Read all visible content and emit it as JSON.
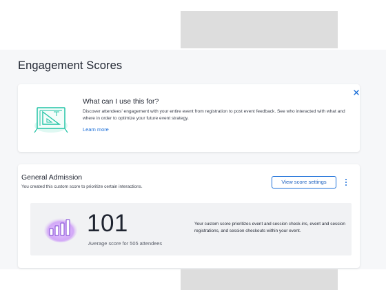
{
  "page": {
    "title": "Engagement Scores"
  },
  "info_card": {
    "title": "What can I use this for?",
    "description": "Discover attendees' engagement with your entire event from registration to post event feedback. See who interacted with what and where in order to optimize your future event strategy.",
    "learn_more": "Learn more",
    "illustration_icon": "blueprint-icon",
    "close_icon": "close-icon"
  },
  "score_card": {
    "title": "General Admission",
    "subtitle": "You created this custom score to prioritize certain interactions.",
    "view_settings_label": "View score settings",
    "more_icon": "more-vertical-icon",
    "score": "101",
    "caption": "Average score for 505 attendees",
    "explanation": "Your custom score prioritizes event and session check-ins, event and session registrations, and session checkouts within your event.",
    "chart_icon": "bar-chart-icon"
  },
  "colors": {
    "accent": "#1a6ed8",
    "teal": "#22c3a6",
    "purple": "#8e5bd9",
    "panel": "#f1f2f4"
  }
}
